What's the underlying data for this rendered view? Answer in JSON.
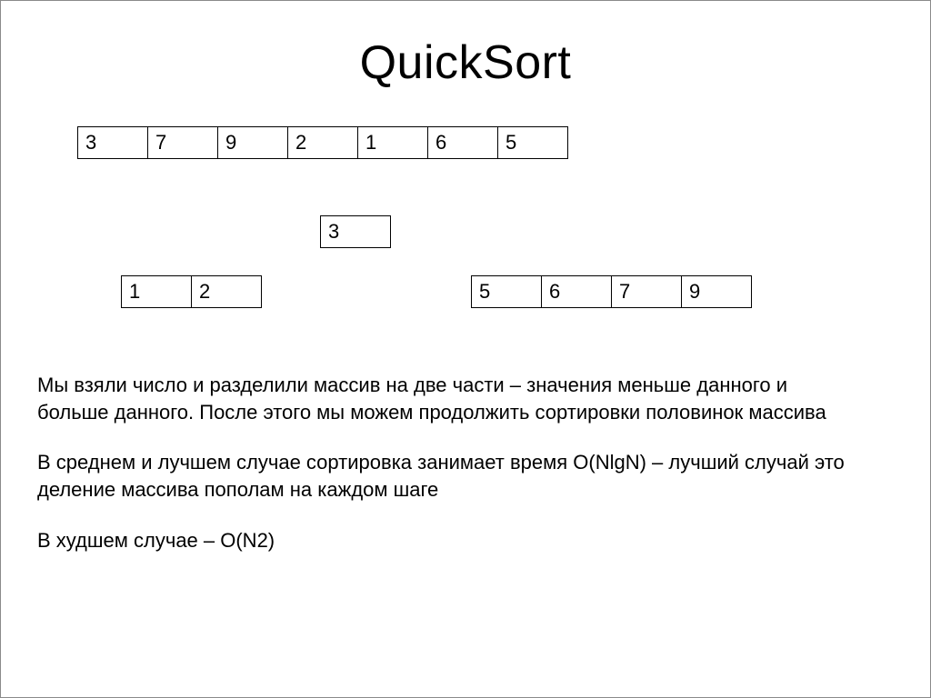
{
  "title": "QuickSort",
  "array": {
    "c0": "3",
    "c1": "7",
    "c2": "9",
    "c3": "2",
    "c4": "1",
    "c5": "6",
    "c6": "5"
  },
  "pivot": "3",
  "left": {
    "c0": "1",
    "c1": "2"
  },
  "right": {
    "c0": "5",
    "c1": "6",
    "c2": "7",
    "c3": "9"
  },
  "para1": "Мы взяли число и разделили массив на две части – значения меньше данного и больше данного. После этого мы можем продолжить сортировки половинок массива",
  "para2": "В среднем и лучшем случае сортировка занимает время O(NlgN) – лучший случай это деление массива пополам на каждом шаге",
  "para3": "В худшем случае – O(N2)"
}
